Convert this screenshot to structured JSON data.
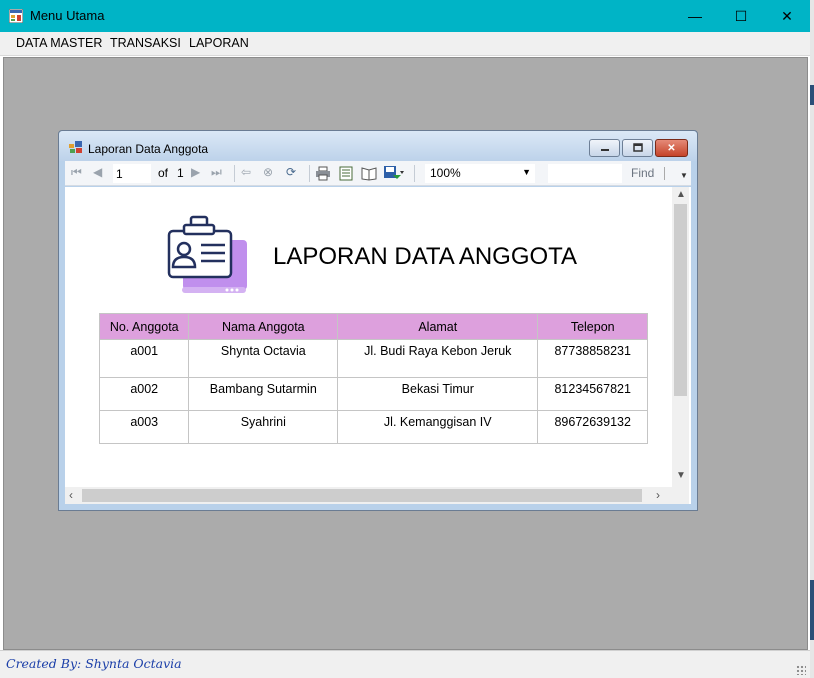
{
  "window": {
    "title": "Menu Utama",
    "minimize": "—",
    "maximize": "☐",
    "close": "✕"
  },
  "menu": [
    "DATA MASTER",
    "TRANSAKSI",
    "LAPORAN"
  ],
  "status": {
    "credit": "Created By: Shynta Octavia"
  },
  "child": {
    "title": "Laporan Data Anggota",
    "close": "✕"
  },
  "toolbar": {
    "page": "1",
    "of_label": "of",
    "total_pages": "1",
    "zoom": "100%",
    "find_label": "Find"
  },
  "report": {
    "title": "LAPORAN DATA ANGGOTA",
    "columns": [
      "No. Anggota",
      "Nama Anggota",
      "Alamat",
      "Telepon"
    ],
    "rows": [
      [
        "a001",
        "Shynta Octavia",
        "Jl. Budi Raya Kebon Jeruk",
        "87738858231"
      ],
      [
        "a002",
        "Bambang Sutarmin",
        "Bekasi Timur",
        "81234567821"
      ],
      [
        "a003",
        "Syahrini",
        "Jl. Kemanggisan IV",
        "89672639132"
      ]
    ]
  },
  "colors": {
    "titlebar": "#00b4c6",
    "header_row": "#dda0dd",
    "workspace": "#ababab",
    "credit_text": "#1a3ea8",
    "icon_accent": "#b57bea",
    "icon_line": "#23305e"
  }
}
